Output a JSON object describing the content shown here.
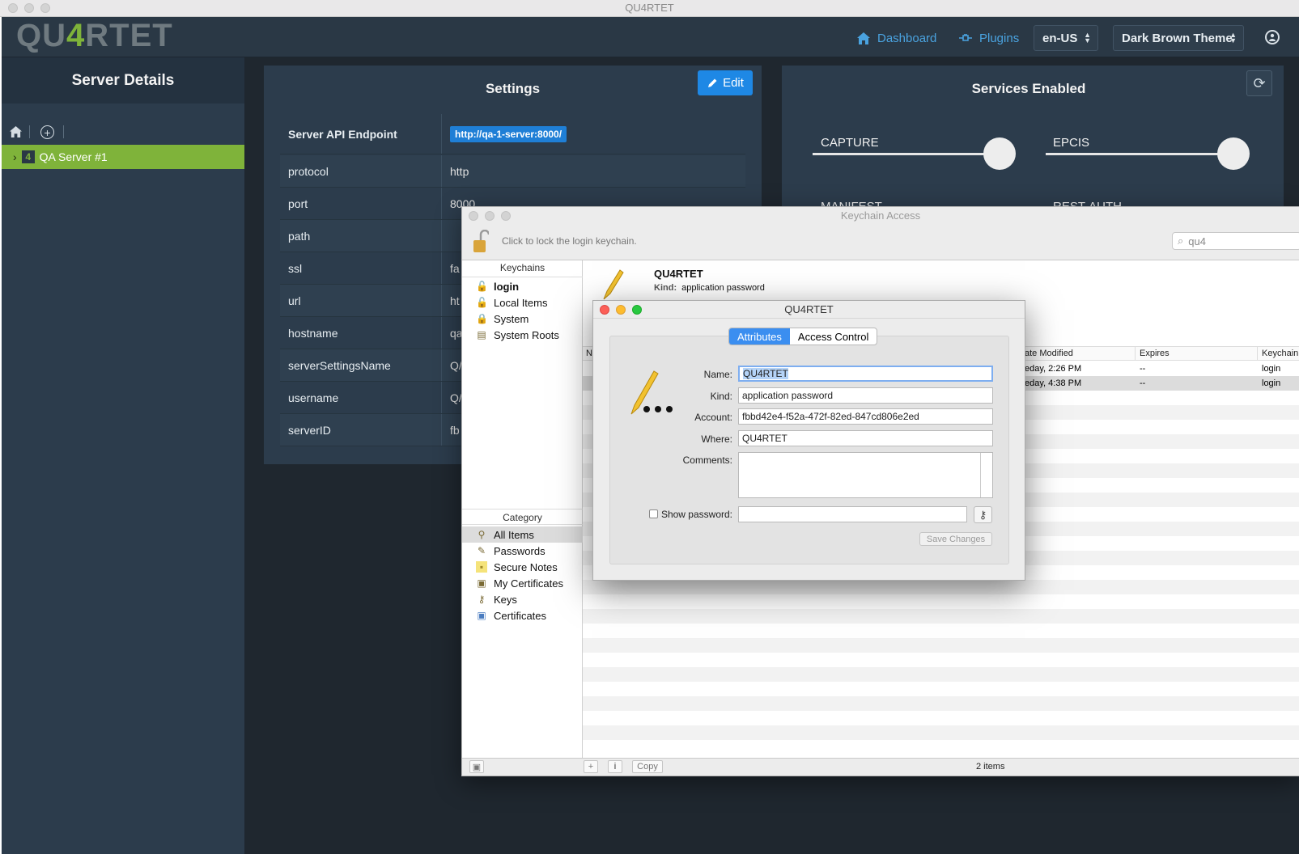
{
  "app": {
    "window_title": "QU4RTET",
    "logo": {
      "part1": "QU",
      "part2": "4",
      "part3": "RTET"
    },
    "nav": {
      "dashboard": "Dashboard",
      "plugins": "Plugins"
    },
    "language": "en-US",
    "theme": "Dark Brown Theme"
  },
  "sidebar": {
    "title": "Server Details",
    "server_name": "QA Server #1"
  },
  "settings": {
    "title": "Settings",
    "edit_label": "Edit",
    "rows": [
      {
        "key": "Server API Endpoint",
        "value": "http://qa-1-server:8000/"
      },
      {
        "key": "protocol",
        "value": "http"
      },
      {
        "key": "port",
        "value": "8000"
      },
      {
        "key": "path",
        "value": ""
      },
      {
        "key": "ssl",
        "value": "fa"
      },
      {
        "key": "url",
        "value": "ht"
      },
      {
        "key": "hostname",
        "value": "qa"
      },
      {
        "key": "serverSettingsName",
        "value": "Q/"
      },
      {
        "key": "username",
        "value": "Q/"
      },
      {
        "key": "serverID",
        "value": "fb"
      }
    ]
  },
  "services": {
    "title": "Services Enabled",
    "items": [
      "CAPTURE",
      "EPCIS",
      "MANIFEST",
      "REST-AUTH"
    ]
  },
  "keychain": {
    "window_title": "Keychain Access",
    "lock_text": "Click to lock the login keychain.",
    "search_value": "qu4",
    "keychains_header": "Keychains",
    "keychains": [
      "login",
      "Local Items",
      "System",
      "System Roots"
    ],
    "category_header": "Category",
    "categories": [
      "All Items",
      "Passwords",
      "Secure Notes",
      "My Certificates",
      "Keys",
      "Certificates"
    ],
    "detail": {
      "name": "QU4RTET",
      "kind_label": "Kind:",
      "kind_value": "application password"
    },
    "columns": {
      "name": "N",
      "date_modified": "ate Modified",
      "expires": "Expires",
      "keychain": "Keychain"
    },
    "rows": [
      {
        "date": "eday, 2:26 PM",
        "expires": "--",
        "keychain": "login"
      },
      {
        "date": "eday, 4:38 PM",
        "expires": "--",
        "keychain": "login"
      }
    ],
    "status": "2 items",
    "copy_label": "Copy"
  },
  "dialog": {
    "title": "QU4RTET",
    "tabs": [
      "Attributes",
      "Access Control"
    ],
    "labels": {
      "name": "Name:",
      "kind": "Kind:",
      "account": "Account:",
      "where": "Where:",
      "comments": "Comments:",
      "show_password": "Show password:"
    },
    "values": {
      "name": "QU4RTET",
      "kind": "application password",
      "account": "fbbd42e4-f52a-472f-82ed-847cd806e2ed",
      "where": "QU4RTET",
      "comments": ""
    },
    "save_label": "Save Changes"
  },
  "colors": {
    "accent_green": "#7fb33a",
    "accent_blue": "#1e88e5",
    "header_bg": "#2a3845"
  }
}
